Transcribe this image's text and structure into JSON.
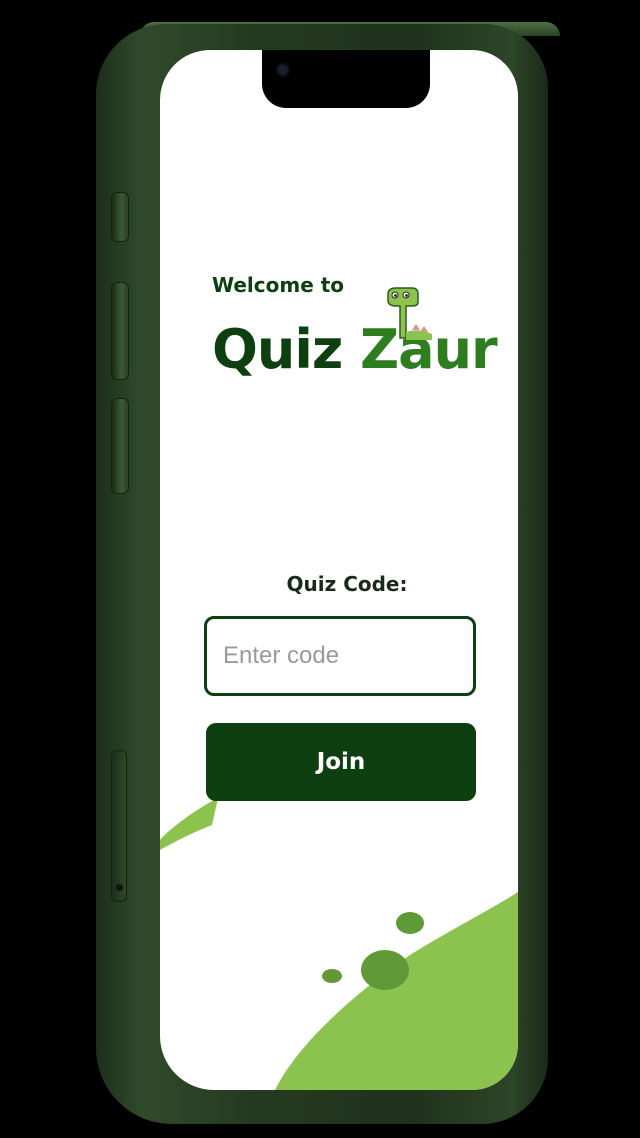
{
  "welcome": {
    "text": "Welcome to"
  },
  "logo": {
    "part1": "Quiz",
    "part2": "Zaur"
  },
  "form": {
    "label": "Quiz Code:",
    "input_placeholder": "Enter code",
    "input_value": "",
    "join_label": "Join"
  },
  "colors": {
    "dark_green": "#0e3f10",
    "accent_green": "#2e7d1e",
    "light_green": "#8cc34f",
    "phone_frame": "#243a20"
  },
  "icons": {
    "mascot": "dinosaur-icon"
  }
}
